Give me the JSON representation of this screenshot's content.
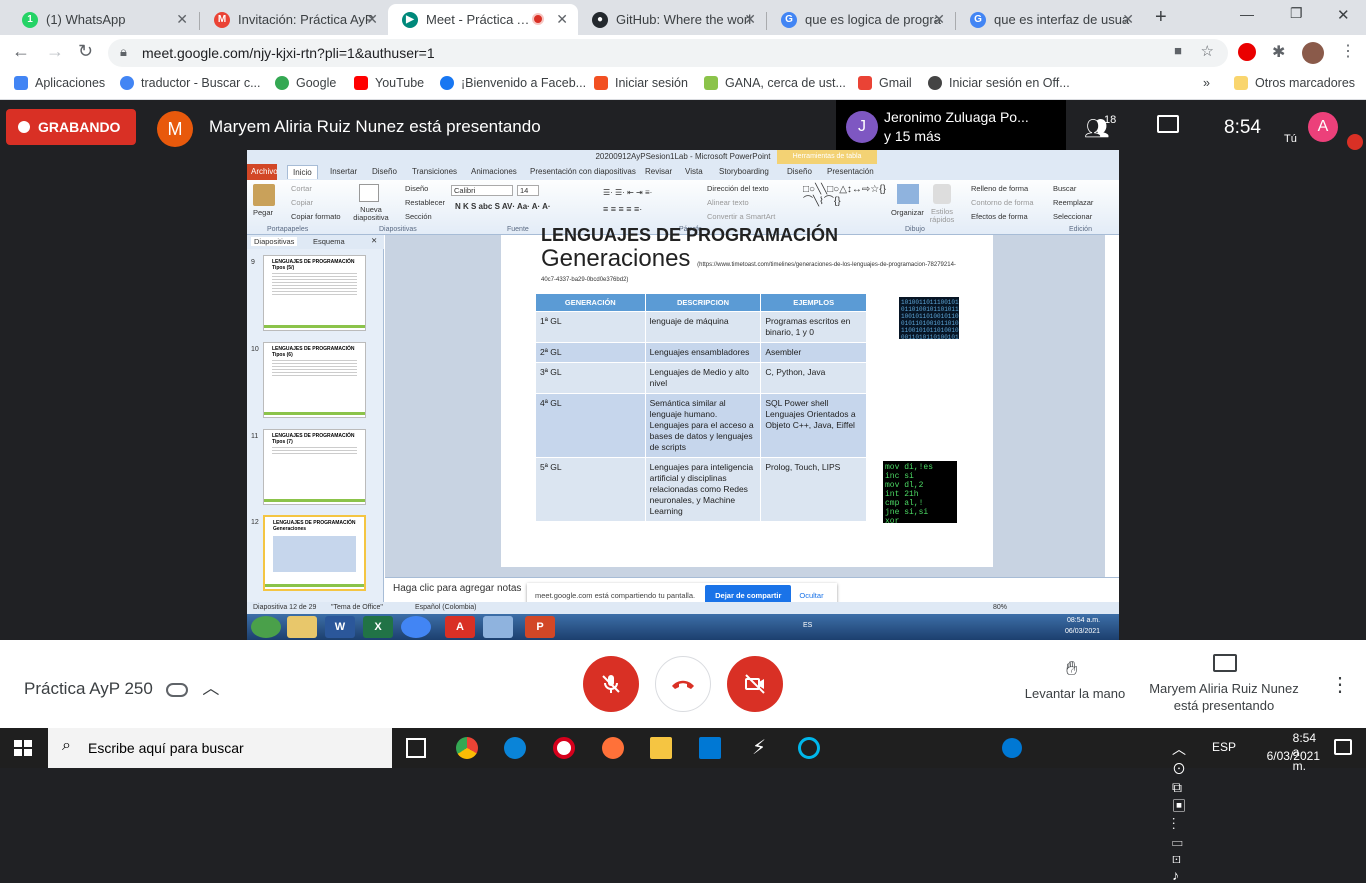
{
  "browser": {
    "tabs": [
      {
        "label": "(1) WhatsApp",
        "color": "#25d366",
        "glyph": "1"
      },
      {
        "label": "Invitación: Práctica AyP",
        "color": "#ea4335",
        "glyph": "M"
      },
      {
        "label": "Meet - Práctica AyP",
        "color": "#00897b",
        "glyph": "▶"
      },
      {
        "label": "GitHub: Where the worl",
        "color": "#24292e",
        "glyph": "●"
      },
      {
        "label": "que es logica de progra",
        "color": "#4285f4",
        "glyph": "G"
      },
      {
        "label": "que es interfaz de usua",
        "color": "#4285f4",
        "glyph": "G"
      }
    ],
    "url": "meet.google.com/njy-kjxi-rtn?pli=1&authuser=1",
    "bookmarks": [
      {
        "label": "Aplicaciones",
        "color": "#4285f4"
      },
      {
        "label": "traductor - Buscar c...",
        "color": "#4285f4"
      },
      {
        "label": "Google",
        "color": "#34a853"
      },
      {
        "label": "YouTube",
        "color": "#ff0000"
      },
      {
        "label": "¡Bienvenido a Faceb...",
        "color": "#1877f2"
      },
      {
        "label": "Iniciar sesión",
        "color": "#f25022"
      },
      {
        "label": "GANA, cerca de ust...",
        "color": "#8bc34a"
      },
      {
        "label": "Gmail",
        "color": "#ea4335"
      },
      {
        "label": "Iniciar sesión en Off...",
        "color": "#444444"
      }
    ],
    "other_bookmarks": "Otros marcadores",
    "more": "»"
  },
  "meet": {
    "recording": "GRABANDO",
    "presenter_initial": "M",
    "presenting": "Maryem Aliria Ruiz Nunez está presentando",
    "pinned_initial": "J",
    "pinned_name": "Jeronimo Zuluaga Po...",
    "pinned_more": "y 15 más",
    "participants": "18",
    "time": "8:54",
    "self_initial": "A",
    "self_label": "Tú",
    "meeting_name": "Práctica AyP 250",
    "raise_hand": "Levantar la mano",
    "presenting_label": "Maryem Aliria Ruiz Nunez está presentando"
  },
  "ppt": {
    "title": "20200912AyPSesion1Lab - Microsoft PowerPoint",
    "tools_label": "Herramientas de tabla",
    "tabs": [
      "Archivo",
      "Inicio",
      "Insertar",
      "Diseño",
      "Transiciones",
      "Animaciones",
      "Presentación con diapositivas",
      "Revisar",
      "Vista",
      "Storyboarding",
      "Diseño",
      "Presentación"
    ],
    "ribbon": {
      "paste": "Pegar",
      "cut": "Cortar",
      "copy": "Copiar",
      "format_copy": "Copiar formato",
      "new_slide": "Nueva diapositiva",
      "layout": "Diseño",
      "reset": "Restablecer",
      "section": "Sección",
      "font": "Calibri",
      "size": "14",
      "text_dir": "Dirección del texto",
      "align_text": "Alinear texto",
      "smartart": "Convertir a SmartArt",
      "organize": "Organizar",
      "styles": "Estilos rápidos",
      "fill": "Relleno de forma",
      "outline": "Contorno de forma",
      "effects": "Efectos de forma",
      "find": "Buscar",
      "replace": "Reemplazar",
      "select": "Seleccionar",
      "groups": [
        "Portapapeles",
        "Diapositivas",
        "Fuente",
        "Párrafo",
        "Dibujo",
        "Edición"
      ]
    },
    "panel_tabs": [
      "Diapositivas",
      "Esquema"
    ],
    "thumbs": [
      {
        "num": "9",
        "title": "LENGUAJES DE PROGRAMACIÓN Tipos (5/)"
      },
      {
        "num": "10",
        "title": "LENGUAJES DE PROGRAMACIÓN Tipos (6)"
      },
      {
        "num": "11",
        "title": "LENGUAJES DE PROGRAMACIÓN Tipos (7)"
      },
      {
        "num": "12",
        "title": "LENGUAJES DE PROGRAMACIÓN Generaciones"
      }
    ],
    "slide": {
      "title_top": "LENGUAJES DE PROGRAMACIÓN",
      "title": "Generaciones",
      "url": "(https://www.timetoast.com/timelines/generaciones-de-los-lenguajes-de-programacion-78279214-",
      "url2": "40c7-4337-ba29-0bcd0e376bd2)",
      "headers": [
        "GENERACIÓN",
        "DESCRIPCION",
        "EJEMPLOS"
      ],
      "rows": [
        [
          "1ª GL",
          "lenguaje de máquina",
          "Programas escritos en binario, 1 y 0"
        ],
        [
          "2ª GL",
          "Lenguajes ensambladores",
          "Asembler"
        ],
        [
          "3ª GL",
          "Lenguajes de Medio y alto nivel",
          "C, Python, Java"
        ],
        [
          "4ª GL",
          "Semántica similar al lenguaje humano. Lenguajes para el acceso a bases de datos y lenguajes de scripts",
          "SQL Power shell Lenguajes Orientados a Objeto  C++, Java, Eiffel"
        ],
        [
          "5ª GL",
          "Lenguajes para inteligencia artificial y disciplinas relacionadas como Redes neuronales, y Machine Learning",
          "Prolog, Touch, LIPS"
        ]
      ]
    },
    "notes": "Haga clic para agregar notas",
    "share_msg": "meet.google.com está compartiendo tu pantalla.",
    "share_stop": "Dejar de compartir",
    "share_hide": "Ocultar",
    "status_slide": "Diapositiva 12 de 29",
    "status_theme": "\"Tema de Office\"",
    "status_lang": "Español (Colombia)",
    "zoom": "80%",
    "inner_lang": "ES",
    "inner_time": "08:54 a.m.",
    "inner_date": "06/03/2021"
  },
  "taskbar": {
    "search": "Escribe aquí para buscar",
    "lang": "ESP",
    "time": "8:54 a. m.",
    "date": "6/03/2021"
  }
}
